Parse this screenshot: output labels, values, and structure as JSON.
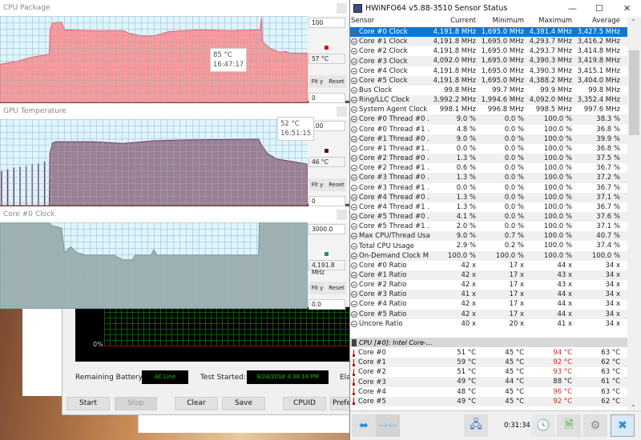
{
  "test_window": {
    "graph_label": "0%",
    "remaining_battery_label": "Remaining Battery:",
    "remaining_battery_value": "AC Line",
    "test_started_label": "Test Started:",
    "test_started_value": "9/24/2018 4:38:16 PM",
    "elapsed_label": "Ela",
    "buttons": {
      "start": "Start",
      "stop": "Stop",
      "clear": "Clear",
      "save": "Save",
      "cpuid": "CPUID",
      "prefs": "Prefe"
    }
  },
  "graphs": [
    {
      "title": "CPU Package",
      "max": "100",
      "min": "0",
      "current": "57 °C",
      "fit": "Fit y",
      "reset": "Reset",
      "tooltip_value": "85 °C",
      "tooltip_time": "16:47:17",
      "fill": "#f89a9a",
      "line": "#e06070",
      "dot": "#e00000",
      "range": [
        0,
        100
      ],
      "samples": [
        [
          0,
          44
        ],
        [
          3,
          46
        ],
        [
          6,
          48
        ],
        [
          10,
          52
        ],
        [
          13,
          54
        ],
        [
          16,
          56
        ],
        [
          16.3,
          85
        ],
        [
          17,
          92
        ],
        [
          20,
          93
        ],
        [
          21,
          84
        ],
        [
          30,
          83
        ],
        [
          40,
          83
        ],
        [
          42,
          80
        ],
        [
          46,
          77
        ],
        [
          50,
          77
        ],
        [
          55,
          82
        ],
        [
          65,
          84
        ],
        [
          75,
          83
        ],
        [
          84.6,
          84
        ],
        [
          85,
          98
        ],
        [
          85.3,
          70
        ],
        [
          88,
          62
        ],
        [
          91,
          58
        ],
        [
          93,
          59
        ],
        [
          94,
          57
        ],
        [
          100,
          57
        ]
      ]
    },
    {
      "title": "GPU Temperature",
      "max": "100",
      "min": "0",
      "current": "46 °C",
      "fit": "Fit y",
      "reset": "Reset",
      "tooltip_value": "52 °C",
      "tooltip_time": "16:51:15",
      "fill": "#9c8094",
      "line": "#6a3a5e",
      "dot": "#50103e",
      "range": [
        0,
        100
      ],
      "spikes": [
        [
          0.5,
          40
        ],
        [
          2.5,
          42
        ],
        [
          4.5,
          44
        ],
        [
          6.5,
          45
        ],
        [
          8.5,
          46
        ],
        [
          10.5,
          48
        ],
        [
          12.5,
          49
        ],
        [
          14.5,
          51
        ]
      ],
      "samples": [
        [
          0,
          0
        ],
        [
          16,
          0
        ],
        [
          16.2,
          60
        ],
        [
          17,
          72
        ],
        [
          18,
          74
        ],
        [
          30,
          74
        ],
        [
          40,
          72
        ],
        [
          50,
          75
        ],
        [
          60,
          76
        ],
        [
          84,
          77
        ],
        [
          85,
          70
        ],
        [
          87,
          60
        ],
        [
          90,
          54
        ],
        [
          95,
          51
        ],
        [
          100,
          48
        ]
      ]
    },
    {
      "title": "Core #0 Clock",
      "max": "3000.0",
      "min": "0.0",
      "current": "4,191.8 MHz",
      "fit": "Fit y",
      "reset": "Reset",
      "fill": "#9fb2b0",
      "line": "#5f9f9a",
      "dot": "#2a8a80",
      "range": [
        0,
        3000
      ],
      "samples": [
        [
          0,
          3000
        ],
        [
          16,
          3000
        ],
        [
          16.5,
          2900
        ],
        [
          20,
          2800
        ],
        [
          21,
          1950
        ],
        [
          23,
          2150
        ],
        [
          25,
          1950
        ],
        [
          28,
          1870
        ],
        [
          37,
          1870
        ],
        [
          40,
          1700
        ],
        [
          43,
          1700
        ],
        [
          44,
          1870
        ],
        [
          49,
          1870
        ],
        [
          50,
          2050
        ],
        [
          51,
          1870
        ],
        [
          84,
          1870
        ],
        [
          84.3,
          3000
        ],
        [
          100,
          3000
        ]
      ]
    }
  ],
  "hwinfo": {
    "title": "HWiNFO64 v5.88-3510 Sensor Status",
    "columns": [
      "Sensor",
      "Current",
      "Minimum",
      "Maximum",
      "Average"
    ],
    "rows": [
      [
        "Core #0 Clock",
        "4,191.8 MHz",
        "1,695.0 MHz",
        "4,391.4 MHz",
        "3,427.5 MHz"
      ],
      [
        "Core #1 Clock",
        "4,191.8 MHz",
        "1,695.0 MHz",
        "4,293.7 MHz",
        "3,416.2 MHz"
      ],
      [
        "Core #2 Clock",
        "4,191.8 MHz",
        "1,695.0 MHz",
        "4,293.7 MHz",
        "3,414.8 MHz"
      ],
      [
        "Core #3 Clock",
        "4,092.0 MHz",
        "1,695.0 MHz",
        "4,390.3 MHz",
        "3,419.8 MHz"
      ],
      [
        "Core #4 Clock",
        "4,191.8 MHz",
        "1,695.0 MHz",
        "4,390.3 MHz",
        "3,415.1 MHz"
      ],
      [
        "Core #5 Clock",
        "4,191.8 MHz",
        "1,695.0 MHz",
        "4,388.2 MHz",
        "3,404.0 MHz"
      ],
      [
        "Bus Clock",
        "99.8 MHz",
        "99.7 MHz",
        "99.9 MHz",
        "99.8 MHz"
      ],
      [
        "Ring/LLC Clock",
        "3,992.2 MHz",
        "1,994.6 MHz",
        "4,092.0 MHz",
        "3,352.4 MHz"
      ],
      [
        "System Agent Clock",
        "998.1 MHz",
        "996.8 MHz",
        "998.5 MHz",
        "997.6 MHz"
      ],
      [
        "Core #0 Thread #0 ...",
        "9.0 %",
        "0.0 %",
        "100.0 %",
        "38.3 %"
      ],
      [
        "Core #0 Thread #1 ...",
        "4.8 %",
        "0.0 %",
        "100.0 %",
        "36.8 %"
      ],
      [
        "Core #1 Thread #0 ...",
        "9.0 %",
        "0.0 %",
        "100.0 %",
        "39.9 %"
      ],
      [
        "Core #1 Thread #1 ...",
        "0.0 %",
        "0.0 %",
        "100.0 %",
        "36.8 %"
      ],
      [
        "Core #2 Thread #0 ...",
        "1.3 %",
        "0.0 %",
        "100.0 %",
        "37.5 %"
      ],
      [
        "Core #2 Thread #1 ...",
        "0.6 %",
        "0.0 %",
        "100.0 %",
        "36.7 %"
      ],
      [
        "Core #3 Thread #0 ...",
        "1.3 %",
        "0.0 %",
        "100.0 %",
        "37.2 %"
      ],
      [
        "Core #3 Thread #1 ...",
        "0.0 %",
        "0.0 %",
        "100.0 %",
        "36.7 %"
      ],
      [
        "Core #4 Thread #0 ...",
        "1.3 %",
        "0.0 %",
        "100.0 %",
        "37.1 %"
      ],
      [
        "Core #4 Thread #1 ...",
        "1.3 %",
        "0.0 %",
        "100.0 %",
        "36.7 %"
      ],
      [
        "Core #5 Thread #0 ...",
        "4.1 %",
        "0.0 %",
        "100.0 %",
        "37.6 %"
      ],
      [
        "Core #5 Thread #1 ...",
        "2.0 %",
        "0.0 %",
        "100.0 %",
        "37.1 %"
      ],
      [
        "Max CPU/Thread Usa",
        "9.0 %",
        "0.7 %",
        "100.0 %",
        "40.7 %"
      ],
      [
        "Total CPU Usage",
        "2.9 %",
        "0.2 %",
        "100.0 %",
        "37.4 %"
      ],
      [
        "On-Demand Clock M...",
        "100.0 %",
        "100.0 %",
        "100.0 %",
        "100.0 %"
      ],
      [
        "Core #0 Ratio",
        "42 x",
        "17 x",
        "44 x",
        "34 x"
      ],
      [
        "Core #1 Ratio",
        "42 x",
        "17 x",
        "43 x",
        "34 x"
      ],
      [
        "Core #2 Ratio",
        "42 x",
        "17 x",
        "43 x",
        "34 x"
      ],
      [
        "Core #3 Ratio",
        "41 x",
        "17 x",
        "44 x",
        "34 x"
      ],
      [
        "Core #4 Ratio",
        "42 x",
        "17 x",
        "44 x",
        "34 x"
      ],
      [
        "Core #5 Ratio",
        "42 x",
        "17 x",
        "44 x",
        "34 x"
      ],
      [
        "Uncore Ratio",
        "40 x",
        "20 x",
        "41 x",
        "34 x"
      ]
    ],
    "group": "CPU [#0]: Intel Core-...",
    "temp_rows": [
      [
        "Core #0",
        "51 °C",
        "45 °C",
        "94 °C",
        "63 °C",
        true
      ],
      [
        "Core #1",
        "59 °C",
        "45 °C",
        "92 °C",
        "62 °C",
        true
      ],
      [
        "Core #2",
        "51 °C",
        "45 °C",
        "93 °C",
        "63 °C",
        true
      ],
      [
        "Core #3",
        "49 °C",
        "44 °C",
        "88 °C",
        "61 °C",
        false
      ],
      [
        "Core #4",
        "48 °C",
        "45 °C",
        "96 °C",
        "63 °C",
        true
      ],
      [
        "Core #5",
        "49 °C",
        "45 °C",
        "92 °C",
        "62 °C",
        true
      ]
    ],
    "timer": "0:31:34",
    "alert_color": "#e02020",
    "selection_color": "#0a78d7"
  }
}
